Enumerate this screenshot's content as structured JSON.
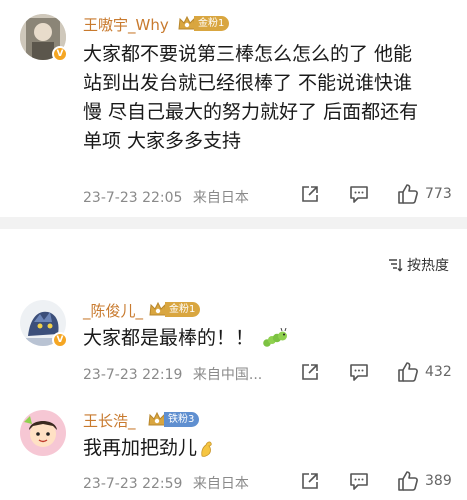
{
  "sort": {
    "label": "按热度"
  },
  "comments": [
    {
      "username": "王嗷宇_Why",
      "badge": "金粉1",
      "text_lines": [
        "大家都不要说第三棒怎么怎么的了 他能",
        "站到出发台就已经很棒了 不能说谁快谁",
        "慢 尽自己最大的努力就好了 后面都还有",
        "单项 大家多多支持"
      ],
      "time": "23-7-23 22:05",
      "source": "来自日本",
      "likes": "773"
    },
    {
      "username": "_陈俊儿_",
      "badge": "金粉1",
      "text": "大家都是最棒的！！",
      "time": "23-7-23 22:19",
      "source": "来自中国...",
      "likes": "432"
    },
    {
      "username": "王长浩_",
      "badge": "铁粉3",
      "text": "我再加把劲儿",
      "time": "23-7-23 22:59",
      "source": "来自日本",
      "likes": "389"
    }
  ],
  "colors": {
    "username": "#c87a2e",
    "gold_badge": "#d9a640",
    "iron_badge": "#5f8fd0",
    "vip": "#f5a623"
  }
}
